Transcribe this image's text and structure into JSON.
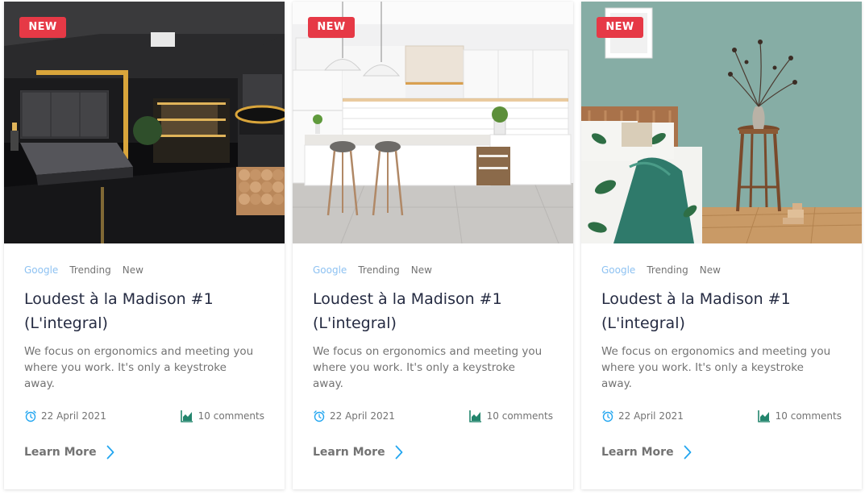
{
  "cards": [
    {
      "badge": "NEW",
      "image_alt": "Dark modern bedroom with glossy black floor, gold lighting, walk-in closet and fireplace",
      "tags": [
        "Google",
        "Trending",
        "New"
      ],
      "title": "Loudest à la Madison #1 (L'integral)",
      "description": "We focus on ergonomics and meeting you where you work. It's only a keystroke away.",
      "date": "22 April 2021",
      "comments": "10 comments",
      "cta": "Learn More"
    },
    {
      "badge": "NEW",
      "image_alt": "Bright white kitchen with island, bar stools, pendant lights and subway tile backsplash",
      "tags": [
        "Google",
        "Trending",
        "New"
      ],
      "title": "Loudest à la Madison #1 (L'integral)",
      "description": "We focus on ergonomics and meeting you where you work. It's only a keystroke away.",
      "date": "22 April 2021",
      "comments": "10 comments",
      "cta": "Learn More"
    },
    {
      "badge": "NEW",
      "image_alt": "Sage green bedroom with wooden bed, leaf-print bedding, stool with vase and parquet floor",
      "tags": [
        "Google",
        "Trending",
        "New"
      ],
      "title": "Loudest à la Madison #1 (L'integral)",
      "description": "We focus on ergonomics and meeting you where you work. It's only a keystroke away.",
      "date": "22 April 2021",
      "comments": "10 comments",
      "cta": "Learn More"
    }
  ],
  "icons": {
    "badge": "new-badge",
    "date": "alarm-clock-icon",
    "comments": "area-chart-icon",
    "cta": "chevron-right-icon"
  },
  "colors": {
    "badge_bg": "#e63946",
    "tag_primary": "#8ec2f2",
    "title": "#252b42",
    "text_muted": "#737373",
    "icon_accent": "#23856d",
    "link_chevron": "#23a6f0"
  }
}
